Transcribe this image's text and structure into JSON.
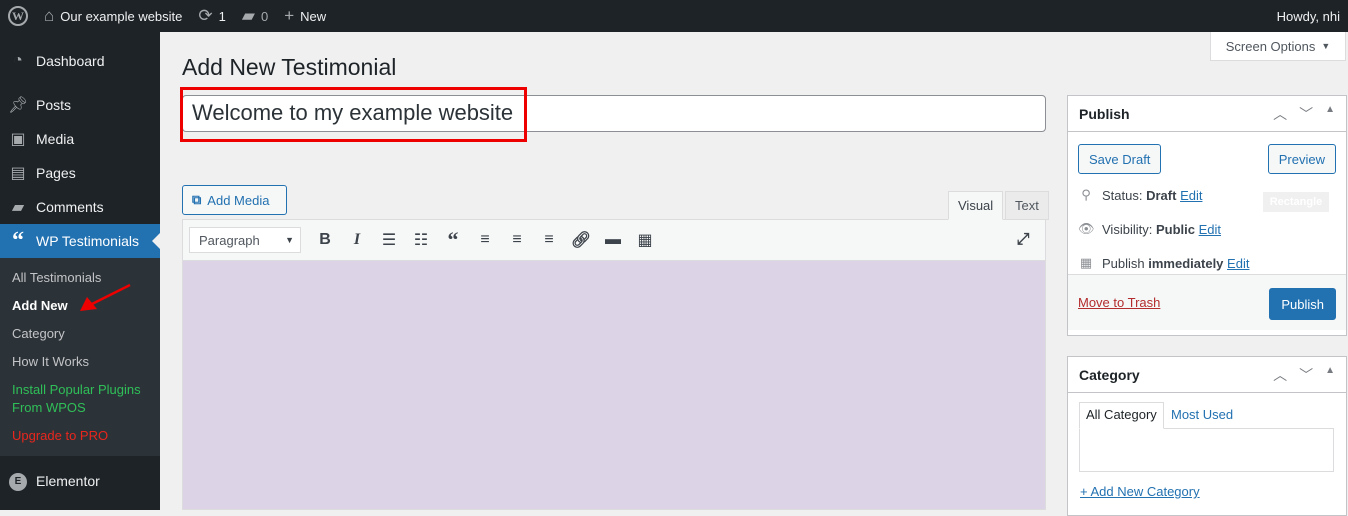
{
  "adminbar": {
    "site": "Our example website",
    "updates": "1",
    "comments": "0",
    "new": "New",
    "howdy": "Howdy, nhi"
  },
  "sidebar": {
    "items": [
      {
        "label": "Dashboard",
        "icon": "dashboard-icon"
      },
      {
        "label": "Posts",
        "icon": "pin-icon"
      },
      {
        "label": "Media",
        "icon": "media-icon"
      },
      {
        "label": "Pages",
        "icon": "pages-icon"
      },
      {
        "label": "Comments",
        "icon": "comment-icon"
      },
      {
        "label": "WP Testimonials",
        "icon": "quote-icon"
      }
    ],
    "submenu": [
      "All Testimonials",
      "Add New",
      "Category",
      "How It Works",
      "Install Popular Plugins From WPOS",
      "Upgrade to PRO"
    ],
    "elementor": "Elementor"
  },
  "page": {
    "title": "Add New Testimonial",
    "screen_options": "Screen Options",
    "post_title": "Welcome to my example website"
  },
  "editor": {
    "add_media": "Add Media",
    "tab_visual": "Visual",
    "tab_text": "Text",
    "format": "Paragraph",
    "content_bg": "#dcd3e6"
  },
  "publish": {
    "title": "Publish",
    "save_draft": "Save Draft",
    "preview": "Preview",
    "status_label": "Status:",
    "status": "Draft",
    "visibility_label": "Visibility:",
    "visibility": "Public",
    "publish_label": "Publish",
    "publish_when": "immediately",
    "edit": "Edit",
    "rectangle": "Rectangle",
    "trash": "Move to Trash",
    "publish_btn": "Publish"
  },
  "category": {
    "title": "Category",
    "tab_all": "All Category",
    "tab_used": "Most Used",
    "add_new": "+ Add New Category"
  }
}
